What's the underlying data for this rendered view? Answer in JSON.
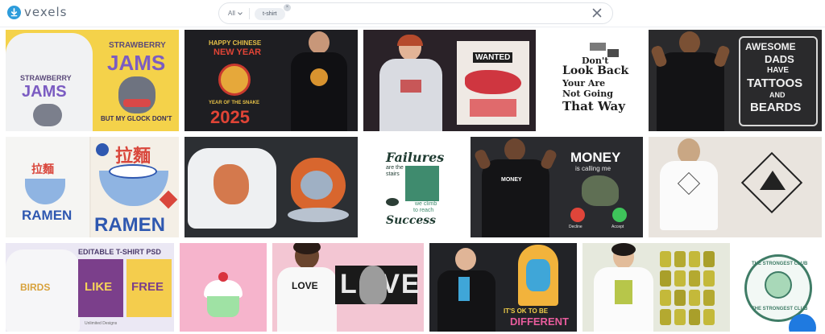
{
  "logo": {
    "text": "vexels",
    "brand_color": "#2d9cdb"
  },
  "search": {
    "category": "All",
    "query_chip": "t-shirt",
    "icons": {
      "category": "chevron-down-icon",
      "chip_remove": "close-icon",
      "clear": "close-icon"
    }
  },
  "designs": {
    "strawberry_jams": {
      "left": "STRAWBERRY",
      "left2": "JAMS",
      "right": "STRAWBERRY",
      "right2": "JAMS",
      "tag": "BUT MY GLOCK DON'T"
    },
    "chinese_new_year": {
      "top": "HAPPY CHINESE",
      "top2": "NEW YEAR",
      "sub": "YEAR OF THE SNAKE",
      "year": "2025"
    },
    "wanted": {
      "title": "WANTED"
    },
    "dont_look_back": {
      "l1": "Don't",
      "l2": "Look Back",
      "l3": "Your Are",
      "l4": "Not Going",
      "l5": "That Way"
    },
    "awesome_dads": {
      "l1": "AWESOME",
      "l2": "DADS",
      "l3": "HAVE",
      "l4": "TATTOOS",
      "l5": "AND",
      "l6": "BEARDS"
    },
    "ramen": {
      "kanji": "拉麵",
      "word": "RAMEN",
      "left_word": "RAMEN"
    },
    "failures": {
      "l1": "Failures",
      "l2": "are the",
      "l3": "stairs",
      "l4": "we climb",
      "l5": "to reach",
      "l6": "Success"
    },
    "money": {
      "title": "MONEY",
      "sub": "is calling me",
      "decline": "Decline",
      "accept": "Accept"
    },
    "editable_psd": {
      "header": "EDITABLE T-SHIRT PSD",
      "word1": "LIKE",
      "word2": "FREE",
      "word3": "BIRDS",
      "footer": "Unlimited Designs"
    },
    "love": {
      "word": "LOVE",
      "word2": "LOVE"
    },
    "different": {
      "l1": "IT'S OK TO BE",
      "l2": "DIFFERENT"
    },
    "strongest_club": {
      "text": "THE STRONGEST CLUB",
      "text2": "THE STRONGEST CLUB"
    }
  }
}
